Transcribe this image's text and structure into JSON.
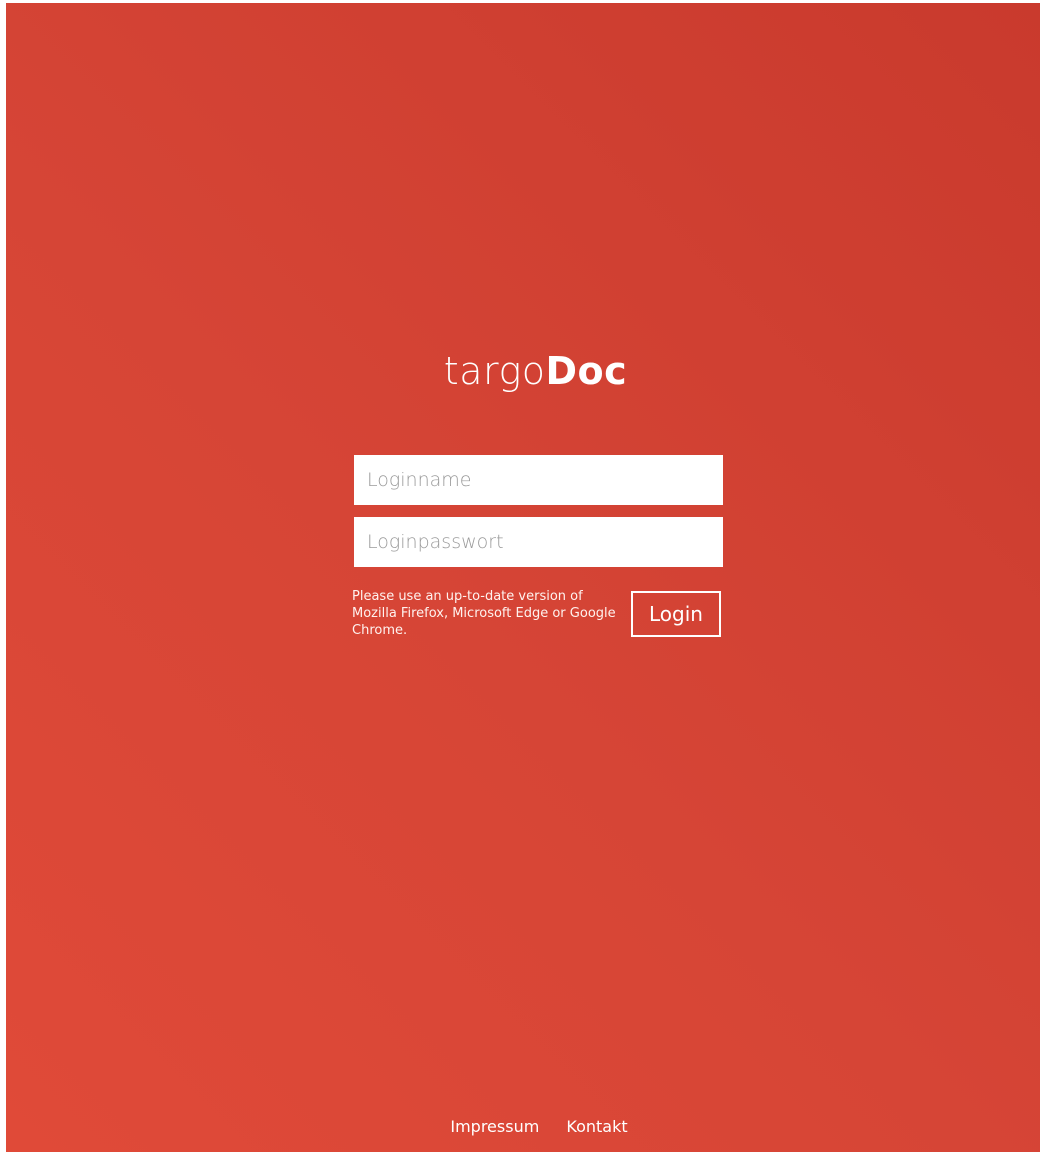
{
  "brand": {
    "prefix": "targo",
    "suffix": "Doc"
  },
  "form": {
    "username_placeholder": "Loginname",
    "username_value": "",
    "password_placeholder": "Loginpasswort",
    "password_value": "",
    "login_label": "Login",
    "browser_hint": "Please use an up-to-date version of Mozilla Firefox, Microsoft Edge or Google Chrome."
  },
  "footer": {
    "links": [
      "Impressum",
      "Kontakt"
    ]
  },
  "colors": {
    "background_start": "#e04a38",
    "background_end": "#c93a2d",
    "text": "#ffffff"
  }
}
